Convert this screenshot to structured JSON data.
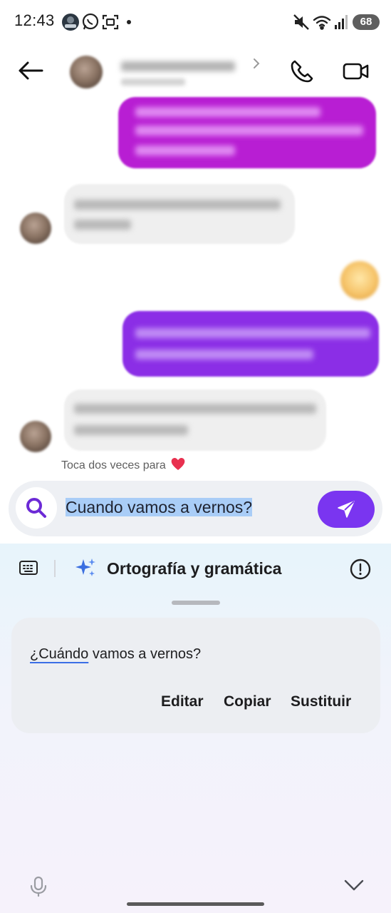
{
  "status_bar": {
    "time": "12:43",
    "battery": "68",
    "icons": [
      "app-avatar-icon",
      "whatsapp-icon",
      "screen-capture-icon",
      "dot-icon",
      "mute-icon",
      "wifi-icon",
      "signal-icon"
    ]
  },
  "header": {
    "contact_name": "",
    "contact_sub": "",
    "icons": [
      "back-arrow-icon",
      "chevron-right-icon",
      "phone-icon",
      "video-call-icon"
    ]
  },
  "messages": {
    "double_tap_hint": "Toca dos veces para",
    "heart": "❤️"
  },
  "composer": {
    "input_value": "Cuando vamos a vernos?",
    "icons": [
      "search-icon",
      "send-icon"
    ]
  },
  "keyboard_panel": {
    "title": "Ortografía y gramática",
    "icons": [
      "keyboard-icon",
      "sparkle-icon",
      "info-icon",
      "microphone-icon",
      "chevron-down-icon"
    ],
    "suggestion_corrected": "¿Cuándo",
    "suggestion_rest": " vamos a vernos?",
    "actions": {
      "edit": "Editar",
      "copy": "Copiar",
      "replace": "Sustituir"
    }
  },
  "colors": {
    "accent": "#7a35f0",
    "bubble_out_magenta": "#b81ed3",
    "bubble_out_violet": "#8b2ee6",
    "bubble_in": "#efefef"
  }
}
